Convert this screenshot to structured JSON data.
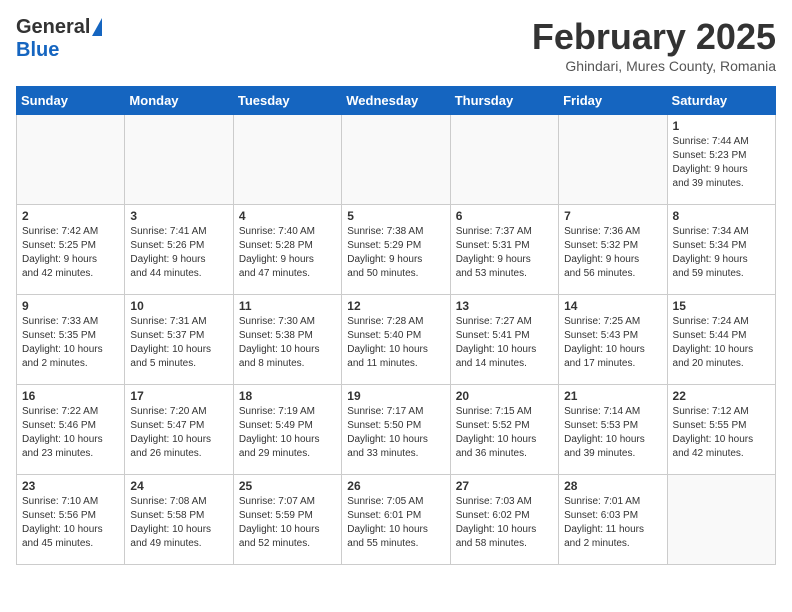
{
  "logo": {
    "general": "General",
    "blue": "Blue"
  },
  "title": "February 2025",
  "subtitle": "Ghindari, Mures County, Romania",
  "weekdays": [
    "Sunday",
    "Monday",
    "Tuesday",
    "Wednesday",
    "Thursday",
    "Friday",
    "Saturday"
  ],
  "weeks": [
    [
      {
        "day": "",
        "info": ""
      },
      {
        "day": "",
        "info": ""
      },
      {
        "day": "",
        "info": ""
      },
      {
        "day": "",
        "info": ""
      },
      {
        "day": "",
        "info": ""
      },
      {
        "day": "",
        "info": ""
      },
      {
        "day": "1",
        "info": "Sunrise: 7:44 AM\nSunset: 5:23 PM\nDaylight: 9 hours\nand 39 minutes."
      }
    ],
    [
      {
        "day": "2",
        "info": "Sunrise: 7:42 AM\nSunset: 5:25 PM\nDaylight: 9 hours\nand 42 minutes."
      },
      {
        "day": "3",
        "info": "Sunrise: 7:41 AM\nSunset: 5:26 PM\nDaylight: 9 hours\nand 44 minutes."
      },
      {
        "day": "4",
        "info": "Sunrise: 7:40 AM\nSunset: 5:28 PM\nDaylight: 9 hours\nand 47 minutes."
      },
      {
        "day": "5",
        "info": "Sunrise: 7:38 AM\nSunset: 5:29 PM\nDaylight: 9 hours\nand 50 minutes."
      },
      {
        "day": "6",
        "info": "Sunrise: 7:37 AM\nSunset: 5:31 PM\nDaylight: 9 hours\nand 53 minutes."
      },
      {
        "day": "7",
        "info": "Sunrise: 7:36 AM\nSunset: 5:32 PM\nDaylight: 9 hours\nand 56 minutes."
      },
      {
        "day": "8",
        "info": "Sunrise: 7:34 AM\nSunset: 5:34 PM\nDaylight: 9 hours\nand 59 minutes."
      }
    ],
    [
      {
        "day": "9",
        "info": "Sunrise: 7:33 AM\nSunset: 5:35 PM\nDaylight: 10 hours\nand 2 minutes."
      },
      {
        "day": "10",
        "info": "Sunrise: 7:31 AM\nSunset: 5:37 PM\nDaylight: 10 hours\nand 5 minutes."
      },
      {
        "day": "11",
        "info": "Sunrise: 7:30 AM\nSunset: 5:38 PM\nDaylight: 10 hours\nand 8 minutes."
      },
      {
        "day": "12",
        "info": "Sunrise: 7:28 AM\nSunset: 5:40 PM\nDaylight: 10 hours\nand 11 minutes."
      },
      {
        "day": "13",
        "info": "Sunrise: 7:27 AM\nSunset: 5:41 PM\nDaylight: 10 hours\nand 14 minutes."
      },
      {
        "day": "14",
        "info": "Sunrise: 7:25 AM\nSunset: 5:43 PM\nDaylight: 10 hours\nand 17 minutes."
      },
      {
        "day": "15",
        "info": "Sunrise: 7:24 AM\nSunset: 5:44 PM\nDaylight: 10 hours\nand 20 minutes."
      }
    ],
    [
      {
        "day": "16",
        "info": "Sunrise: 7:22 AM\nSunset: 5:46 PM\nDaylight: 10 hours\nand 23 minutes."
      },
      {
        "day": "17",
        "info": "Sunrise: 7:20 AM\nSunset: 5:47 PM\nDaylight: 10 hours\nand 26 minutes."
      },
      {
        "day": "18",
        "info": "Sunrise: 7:19 AM\nSunset: 5:49 PM\nDaylight: 10 hours\nand 29 minutes."
      },
      {
        "day": "19",
        "info": "Sunrise: 7:17 AM\nSunset: 5:50 PM\nDaylight: 10 hours\nand 33 minutes."
      },
      {
        "day": "20",
        "info": "Sunrise: 7:15 AM\nSunset: 5:52 PM\nDaylight: 10 hours\nand 36 minutes."
      },
      {
        "day": "21",
        "info": "Sunrise: 7:14 AM\nSunset: 5:53 PM\nDaylight: 10 hours\nand 39 minutes."
      },
      {
        "day": "22",
        "info": "Sunrise: 7:12 AM\nSunset: 5:55 PM\nDaylight: 10 hours\nand 42 minutes."
      }
    ],
    [
      {
        "day": "23",
        "info": "Sunrise: 7:10 AM\nSunset: 5:56 PM\nDaylight: 10 hours\nand 45 minutes."
      },
      {
        "day": "24",
        "info": "Sunrise: 7:08 AM\nSunset: 5:58 PM\nDaylight: 10 hours\nand 49 minutes."
      },
      {
        "day": "25",
        "info": "Sunrise: 7:07 AM\nSunset: 5:59 PM\nDaylight: 10 hours\nand 52 minutes."
      },
      {
        "day": "26",
        "info": "Sunrise: 7:05 AM\nSunset: 6:01 PM\nDaylight: 10 hours\nand 55 minutes."
      },
      {
        "day": "27",
        "info": "Sunrise: 7:03 AM\nSunset: 6:02 PM\nDaylight: 10 hours\nand 58 minutes."
      },
      {
        "day": "28",
        "info": "Sunrise: 7:01 AM\nSunset: 6:03 PM\nDaylight: 11 hours\nand 2 minutes."
      },
      {
        "day": "",
        "info": ""
      }
    ]
  ]
}
